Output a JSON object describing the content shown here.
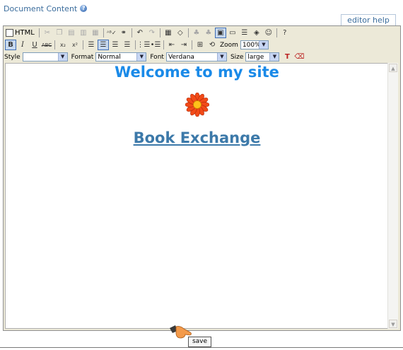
{
  "header": {
    "title": "Document Content",
    "help_icon": "question-circle-icon"
  },
  "editor_help": "editor help",
  "toolbar1": {
    "html_label": "HTML",
    "icons": [
      "cut-icon",
      "copy-icon",
      "paste-icon",
      "paste-text-icon",
      "paste-word-icon",
      "spellcheck-icon",
      "find-icon",
      "undo-icon",
      "redo-icon",
      "table-icon",
      "eraser-icon",
      "image-icon",
      "image-alt-icon",
      "image-insert-icon",
      "window-icon",
      "horizontal-rule-icon",
      "object-icon",
      "smiley-icon",
      "help-icon"
    ]
  },
  "toolbar2": {
    "bold": "B",
    "italic": "I",
    "underline": "U",
    "strike": "ABC",
    "subscript": "x₂",
    "superscript": "x²",
    "zoom_label": "Zoom",
    "zoom_value": "100%"
  },
  "toolbar3": {
    "style_label": "Style",
    "style_value": "",
    "format_label": "Format",
    "format_value": "Normal",
    "font_label": "Font",
    "font_value": "Verdana",
    "size_label": "Size",
    "size_value": "large",
    "icons": [
      "text-color-icon",
      "highlight-color-icon"
    ]
  },
  "content": {
    "heading": "Welcome to my site",
    "image": "flower-icon",
    "link": "Book Exchange"
  },
  "save": {
    "label": "save",
    "pointer_icon": "pointing-hand-icon"
  },
  "colors": {
    "heading": "#1a8ae8",
    "link": "#3c79a9",
    "toolbar_bg": "#ece9d8"
  }
}
